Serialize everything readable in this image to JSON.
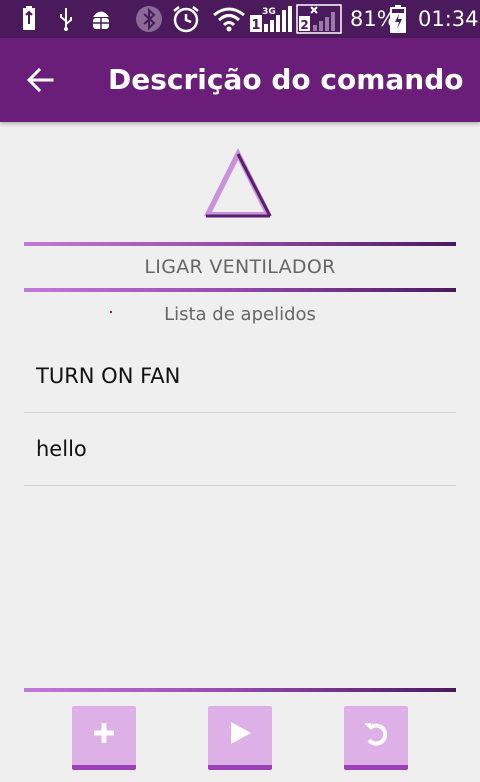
{
  "status_bar": {
    "network_3g_label": "3G",
    "sim1_label": "1",
    "sim2_label": "2",
    "battery_percent": "81%",
    "time": "01:34"
  },
  "app_bar": {
    "title": "Descrição do comando"
  },
  "command": {
    "name": "LIGAR VENTILADOR"
  },
  "aliases": {
    "header": "Lista de apelidos",
    "items": [
      "TURN ON FAN",
      "hello"
    ]
  },
  "actions": {
    "add_icon": "plus-icon",
    "play_icon": "play-icon",
    "undo_icon": "undo-icon"
  },
  "colors": {
    "status_bar": "#4a1a5c",
    "app_bar": "#6a1e79",
    "accent_light": "#ddb1e8",
    "accent_dark": "#9b40b8"
  }
}
